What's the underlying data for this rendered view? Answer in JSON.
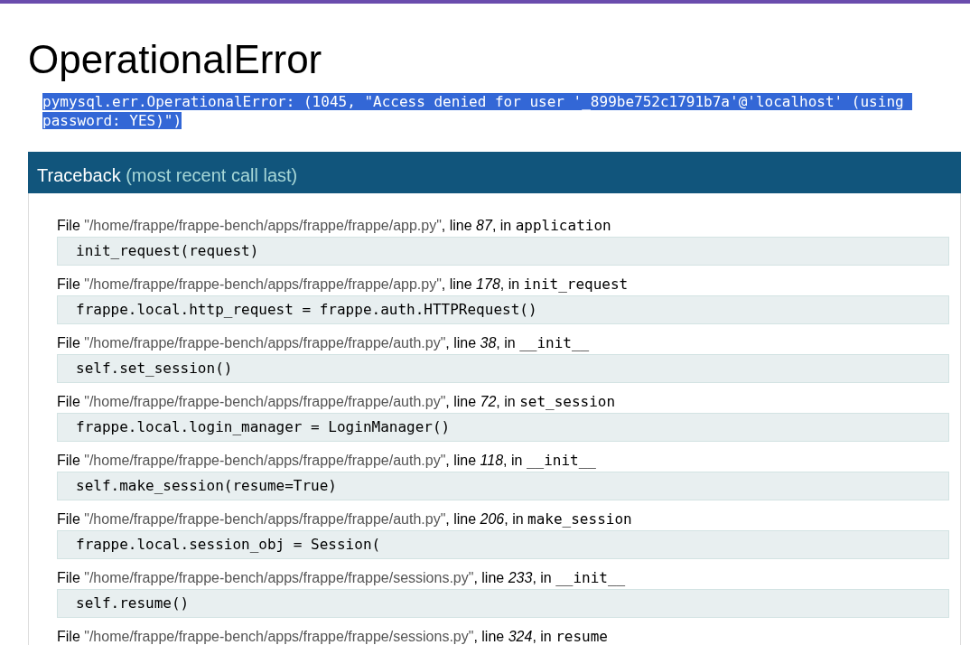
{
  "title": "OperationalError",
  "error_message": {
    "text": "pymysql.err.OperationalError: (1045, \"Access denied for user '_899be752c1791b7a'@'localhost' (using password: YES)\")",
    "selected": true
  },
  "traceback": {
    "title": "Traceback",
    "subtitle": "(most recent call last)",
    "frames": [
      {
        "file_label": "File ",
        "path": "\"/home/frappe/frappe-bench/apps/frappe/frappe/app.py\"",
        "line_label": ", line ",
        "line": "87",
        "in_label": ", in ",
        "function": "application",
        "code": "init_request(request)"
      },
      {
        "file_label": "File ",
        "path": "\"/home/frappe/frappe-bench/apps/frappe/frappe/app.py\"",
        "line_label": ", line ",
        "line": "178",
        "in_label": ", in ",
        "function": "init_request",
        "code": "frappe.local.http_request = frappe.auth.HTTPRequest()"
      },
      {
        "file_label": "File ",
        "path": "\"/home/frappe/frappe-bench/apps/frappe/frappe/auth.py\"",
        "line_label": ", line ",
        "line": "38",
        "in_label": ", in ",
        "function": "__init__",
        "code": "self.set_session()"
      },
      {
        "file_label": "File ",
        "path": "\"/home/frappe/frappe-bench/apps/frappe/frappe/auth.py\"",
        "line_label": ", line ",
        "line": "72",
        "in_label": ", in ",
        "function": "set_session",
        "code": "frappe.local.login_manager = LoginManager()"
      },
      {
        "file_label": "File ",
        "path": "\"/home/frappe/frappe-bench/apps/frappe/frappe/auth.py\"",
        "line_label": ", line ",
        "line": "118",
        "in_label": ", in ",
        "function": "__init__",
        "code": "self.make_session(resume=True)"
      },
      {
        "file_label": "File ",
        "path": "\"/home/frappe/frappe-bench/apps/frappe/frappe/auth.py\"",
        "line_label": ", line ",
        "line": "206",
        "in_label": ", in ",
        "function": "make_session",
        "code": "frappe.local.session_obj = Session("
      },
      {
        "file_label": "File ",
        "path": "\"/home/frappe/frappe-bench/apps/frappe/frappe/sessions.py\"",
        "line_label": ", line ",
        "line": "233",
        "in_label": ", in ",
        "function": "__init__",
        "code": "self.resume()"
      },
      {
        "file_label": "File ",
        "path": "\"/home/frappe/frappe-bench/apps/frappe/frappe/sessions.py\"",
        "line_label": ", line ",
        "line": "324",
        "in_label": ", in ",
        "function": "resume"
      }
    ]
  }
}
